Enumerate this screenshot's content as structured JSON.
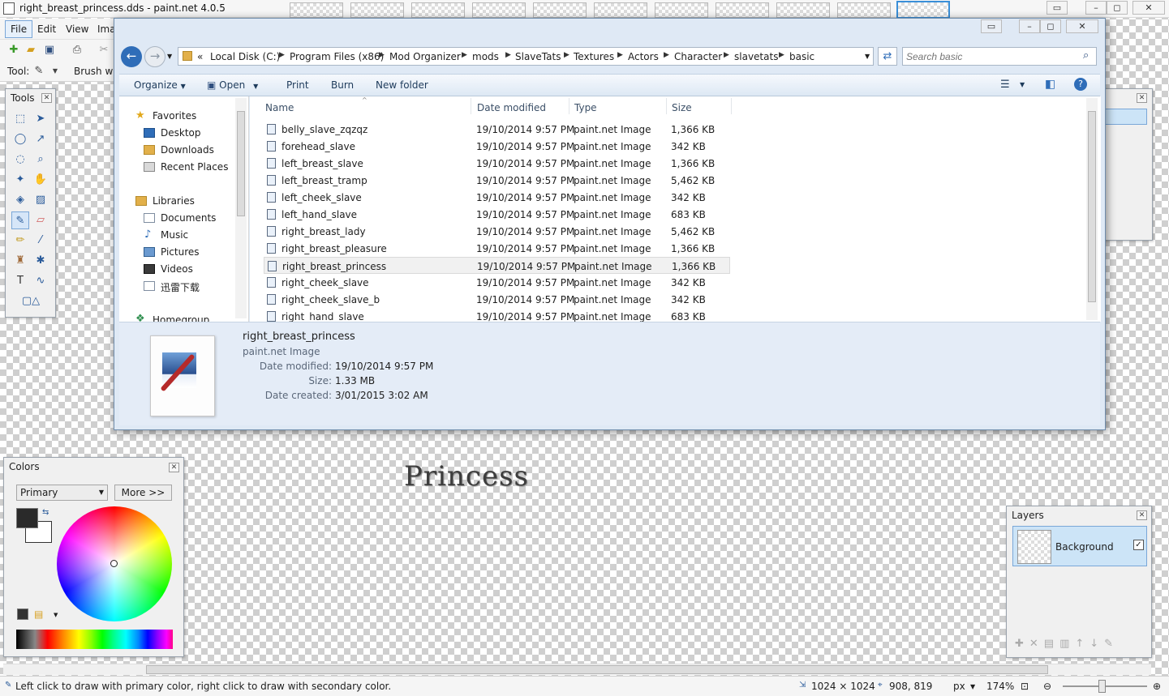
{
  "app": {
    "title": "right_breast_princess.dds - paint.net 4.0.5",
    "menu": [
      "File",
      "Edit",
      "View",
      "Ima"
    ],
    "toolbar": {
      "tool_label": "Tool:",
      "brush_label": "Brush wid"
    }
  },
  "canvas": {
    "text": "Princess"
  },
  "tools_panel": {
    "title": "Tools"
  },
  "colors_panel": {
    "title": "Colors",
    "mode": "Primary",
    "more_button": "More >>"
  },
  "layers_panel": {
    "title": "Layers",
    "layer_name": "Background"
  },
  "explorer": {
    "breadcrumb": [
      "«",
      "Local Disk (C:)",
      "Program Files (x86)",
      "Mod Organizer",
      "mods",
      "SlaveTats",
      "Textures",
      "Actors",
      "Character",
      "slavetats",
      "basic"
    ],
    "search_placeholder": "Search basic",
    "commands": {
      "organize": "Organize",
      "open": "Open",
      "print": "Print",
      "burn": "Burn",
      "new_folder": "New folder"
    },
    "nav": {
      "favorites": "Favorites",
      "favorites_items": [
        "Desktop",
        "Downloads",
        "Recent Places"
      ],
      "libraries": "Libraries",
      "libraries_items": [
        "Documents",
        "Music",
        "Pictures",
        "Videos",
        "迅雷下载"
      ],
      "homegroup": "Homegroup"
    },
    "columns": [
      "Name",
      "Date modified",
      "Type",
      "Size"
    ],
    "files": [
      {
        "name": "belly_slave_zqzqz",
        "date": "19/10/2014 9:57 PM",
        "type": "paint.net Image",
        "size": "1,366 KB"
      },
      {
        "name": "forehead_slave",
        "date": "19/10/2014 9:57 PM",
        "type": "paint.net Image",
        "size": "342 KB"
      },
      {
        "name": "left_breast_slave",
        "date": "19/10/2014 9:57 PM",
        "type": "paint.net Image",
        "size": "1,366 KB"
      },
      {
        "name": "left_breast_tramp",
        "date": "19/10/2014 9:57 PM",
        "type": "paint.net Image",
        "size": "5,462 KB"
      },
      {
        "name": "left_cheek_slave",
        "date": "19/10/2014 9:57 PM",
        "type": "paint.net Image",
        "size": "342 KB"
      },
      {
        "name": "left_hand_slave",
        "date": "19/10/2014 9:57 PM",
        "type": "paint.net Image",
        "size": "683 KB"
      },
      {
        "name": "right_breast_lady",
        "date": "19/10/2014 9:57 PM",
        "type": "paint.net Image",
        "size": "5,462 KB"
      },
      {
        "name": "right_breast_pleasure",
        "date": "19/10/2014 9:57 PM",
        "type": "paint.net Image",
        "size": "1,366 KB"
      },
      {
        "name": "right_breast_princess",
        "date": "19/10/2014 9:57 PM",
        "type": "paint.net Image",
        "size": "1,366 KB"
      },
      {
        "name": "right_cheek_slave",
        "date": "19/10/2014 9:57 PM",
        "type": "paint.net Image",
        "size": "342 KB"
      },
      {
        "name": "right_cheek_slave_b",
        "date": "19/10/2014 9:57 PM",
        "type": "paint.net Image",
        "size": "342 KB"
      },
      {
        "name": "right_hand_slave",
        "date": "19/10/2014 9:57 PM",
        "type": "paint.net Image",
        "size": "683 KB"
      }
    ],
    "selected_index": 8,
    "details": {
      "filename": "right_breast_princess",
      "filetype": "paint.net Image",
      "modified_label": "Date modified:",
      "modified": "19/10/2014 9:57 PM",
      "size_label": "Size:",
      "size": "1.33 MB",
      "created_label": "Date created:",
      "created": "3/01/2015 3:02 AM"
    }
  },
  "status": {
    "hint": "Left click to draw with primary color, right click to draw with secondary color.",
    "image_size": "1024 × 1024",
    "cursor": "908, 819",
    "unit": "px",
    "zoom": "174%"
  },
  "colors": {
    "accent": "#3a8fd8",
    "selection": "#cce4f7"
  }
}
